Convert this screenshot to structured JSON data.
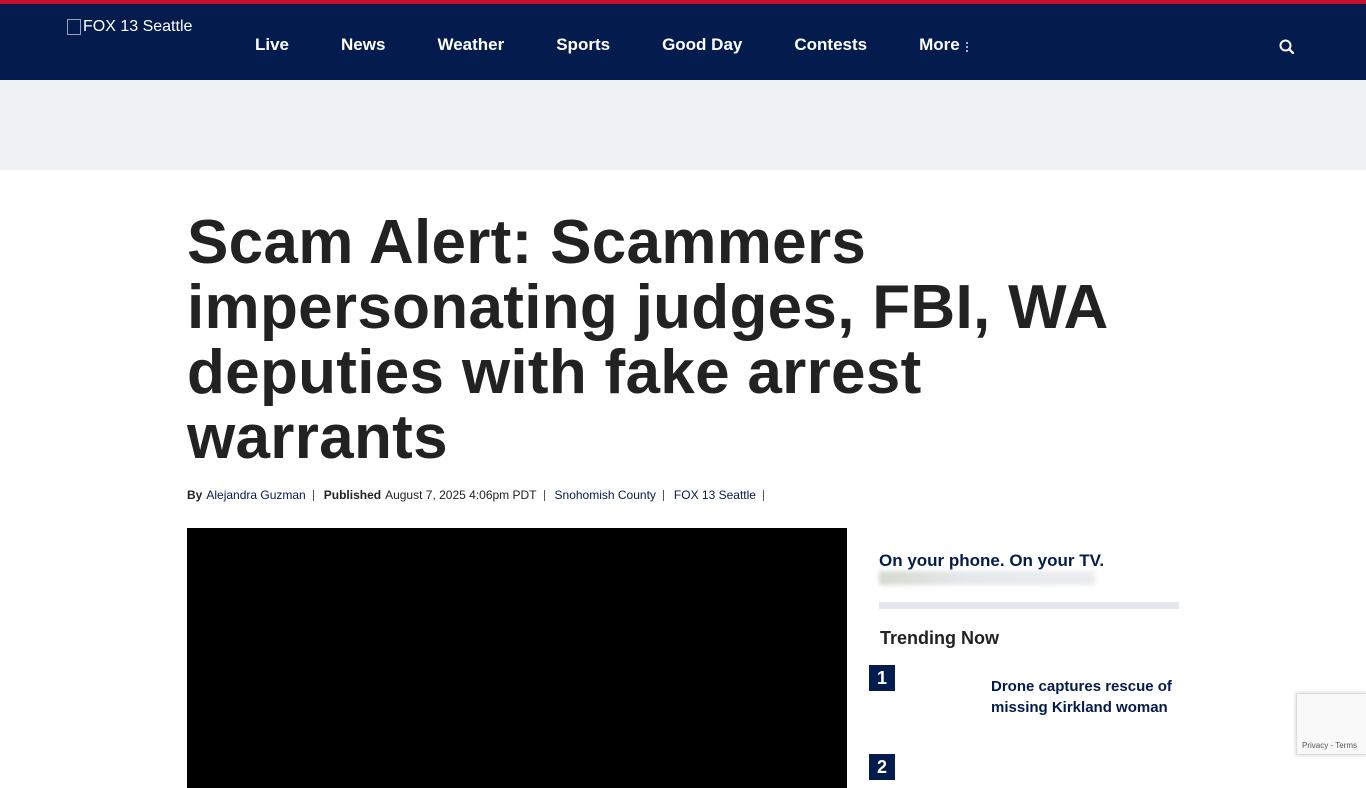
{
  "brand": {
    "logo_alt": "FOX 13 Seattle",
    "accent": "#c8102e",
    "nav_bg": "#041b4d"
  },
  "nav": {
    "items": [
      {
        "label": "Live"
      },
      {
        "label": "News"
      },
      {
        "label": "Weather"
      },
      {
        "label": "Sports"
      },
      {
        "label": "Good Day"
      },
      {
        "label": "Contests"
      },
      {
        "label": "More"
      }
    ],
    "search_icon": "search-icon"
  },
  "article": {
    "headline": "Scam Alert: Scammers impersonating judges, FBI, WA deputies with fake arrest warrants",
    "byline_prefix": "By",
    "author": "Alejandra Guzman",
    "published_label": "Published",
    "published_date": "August 7, 2025 4:06pm PDT",
    "category": "Snohomish County",
    "source": "FOX 13 Seattle"
  },
  "sidebar": {
    "promo_title": "On your phone. On your TV.",
    "trending_title": "Trending Now",
    "trending": [
      {
        "rank": "1",
        "title": "Drone captures rescue of missing Kirkland woman"
      },
      {
        "rank": "2",
        "title": ""
      }
    ]
  },
  "recaptcha": {
    "privacy": "Privacy",
    "terms": "Terms",
    "separator": " - "
  }
}
